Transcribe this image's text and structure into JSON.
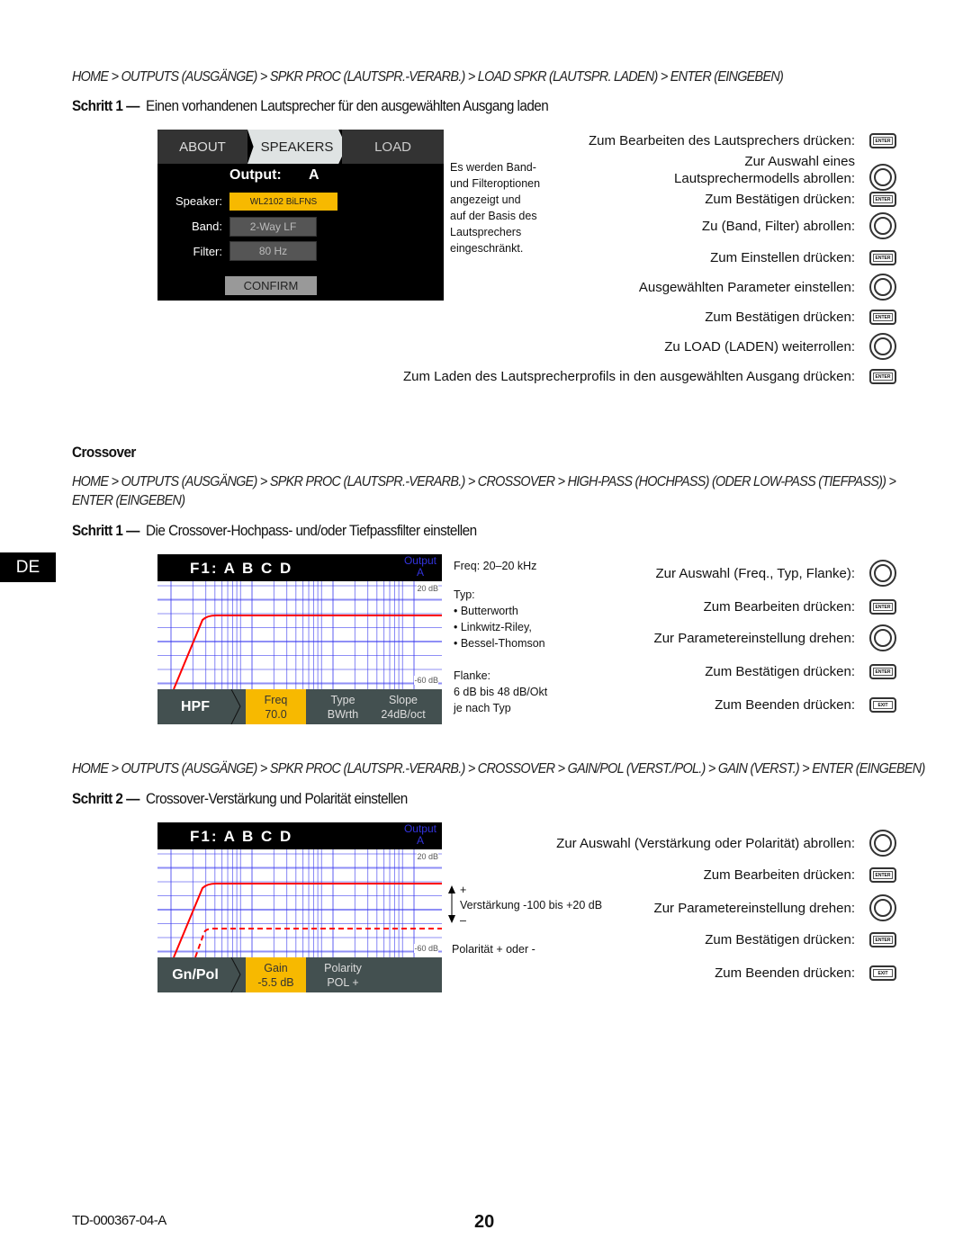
{
  "section1": {
    "breadcrumb": "HOME > OUTPUTS (AUSGÄNGE) > SPKR PROC (LAUTSPR.-VERARB.) > LOAD SPKR (LAUTSPR. LADEN) > ENTER (EINGEBEN)",
    "step_label": "Schritt 1 —",
    "step_title": "Einen vorhandenen Lautsprecher für den ausgewählten Ausgang laden",
    "screen": {
      "tabs": [
        "ABOUT",
        "SPEAKERS",
        "LOAD"
      ],
      "output_label": "Output:",
      "output_value": "A",
      "speaker_label": "Speaker:",
      "speaker_value": "WL2102 BiLFNS",
      "band_label": "Band:",
      "band_value": "2-Way LF",
      "filter_label": "Filter:",
      "filter_value": "80 Hz",
      "confirm": "CONFIRM"
    },
    "note": [
      "Es werden Band-",
      "und Filteroptionen",
      "angezeigt und",
      "auf der Basis des",
      "Lautsprechers",
      "eingeschränkt."
    ],
    "instructions": [
      {
        "text": "Zum Bearbeiten des Lautsprechers drücken:",
        "icon": "enter"
      },
      {
        "text": "Zur Auswahl eines",
        "text2": "Lautsprechermodells abrollen:",
        "icon": "knob"
      },
      {
        "text": "Zum Bestätigen drücken:",
        "icon": "enter"
      },
      {
        "text": "Zu (Band, Filter) abrollen:",
        "icon": "knob"
      },
      {
        "text": "Zum Einstellen drücken:",
        "icon": "enter"
      },
      {
        "text": "Ausgewählten Parameter einstellen:",
        "icon": "knob"
      },
      {
        "text": "Zum Bestätigen drücken:",
        "icon": "enter"
      },
      {
        "text": "Zu LOAD (LADEN) weiterrollen:",
        "icon": "knob"
      },
      {
        "text": "Zum Laden des Lautsprecherprofils in den ausgewählten Ausgang drücken:",
        "icon": "enter"
      }
    ]
  },
  "crossover_heading": "Crossover",
  "section2": {
    "breadcrumb_line1": "HOME > OUTPUTS (AUSGÄNGE) > SPKR PROC (LAUTSPR.-VERARB.) > CROSSOVER > HIGH-PASS (HOCHPASS) (ODER LOW-PASS (TIEFPASS)) >",
    "breadcrumb_line2": "ENTER (EINGEBEN)",
    "step_label": "Schritt 1 —",
    "step_title": "Die Crossover-Hochpass- und/oder Tiefpassfilter einstellen",
    "screen": {
      "title": "F1: A B C D",
      "output_label": "Output",
      "output_value": "A",
      "db_top": "20 dB",
      "db_bottom": "-60 dB",
      "mode": "HPF",
      "freq_label": "Freq",
      "freq_value": "70.0",
      "type_label": "Type",
      "type_value": "BWrth",
      "slope_label": "Slope",
      "slope_value": "24dB/oct"
    },
    "note": {
      "freq": "Freq: 20–20 kHz",
      "typ": "Typ:",
      "types": [
        "• Butterworth",
        "• Linkwitz-Riley,",
        "• Bessel-Thomson"
      ],
      "flanke": "Flanke:",
      "flanke_range": "6 dB bis 48 dB/Okt",
      "flanke_note": "je nach Typ"
    },
    "instructions": [
      {
        "text": "Zur Auswahl (Freq., Typ, Flanke):",
        "icon": "knob"
      },
      {
        "text": "Zum Bearbeiten drücken:",
        "icon": "enter"
      },
      {
        "text": "Zur Parametereinstellung drehen:",
        "icon": "knob"
      },
      {
        "text": "Zum Bestätigen drücken:",
        "icon": "enter"
      },
      {
        "text": "Zum Beenden drücken:",
        "icon": "exit"
      }
    ]
  },
  "section3": {
    "breadcrumb": "HOME > OUTPUTS (AUSGÄNGE) > SPKR PROC (LAUTSPR.-VERARB.) > CROSSOVER > GAIN/POL (VERST./POL.) > GAIN (VERST.) > ENTER (EINGEBEN)",
    "step_label": "Schritt 2 —",
    "step_title": "Crossover-Verstärkung und Polarität einstellen",
    "screen": {
      "title": "F1: A B C D",
      "output_label": "Output",
      "output_value": "A",
      "db_top": "20 dB",
      "db_bottom": "-60 dB",
      "mode": "Gn/Pol",
      "gain_label": "Gain",
      "gain_value": "-5.5 dB",
      "polarity_label": "Polarity",
      "polarity_value": "POL +"
    },
    "note": {
      "plus": "+",
      "gain_range": "Verstärkung -100 bis +20 dB",
      "minus": "–",
      "polarity": "Polarität + oder -"
    },
    "instructions": [
      {
        "text": "Zur Auswahl (Verstärkung oder Polarität) abrollen:",
        "icon": "knob"
      },
      {
        "text": "Zum Bearbeiten drücken:",
        "icon": "enter"
      },
      {
        "text": "Zur Parametereinstellung drehen:",
        "icon": "knob"
      },
      {
        "text": "Zum Bestätigen drücken:",
        "icon": "enter"
      },
      {
        "text": "Zum Beenden drücken:",
        "icon": "exit"
      }
    ]
  },
  "icons": {
    "enter": "ENTER",
    "exit": "EXIT"
  },
  "language_tab": "DE",
  "footer": {
    "doc_id": "TD-000367-04-A",
    "page": "20"
  },
  "colors": {
    "highlight": "#f7b900",
    "curve": "#ff0000",
    "grid": "#3333ee",
    "footer_bar": "#435050"
  }
}
